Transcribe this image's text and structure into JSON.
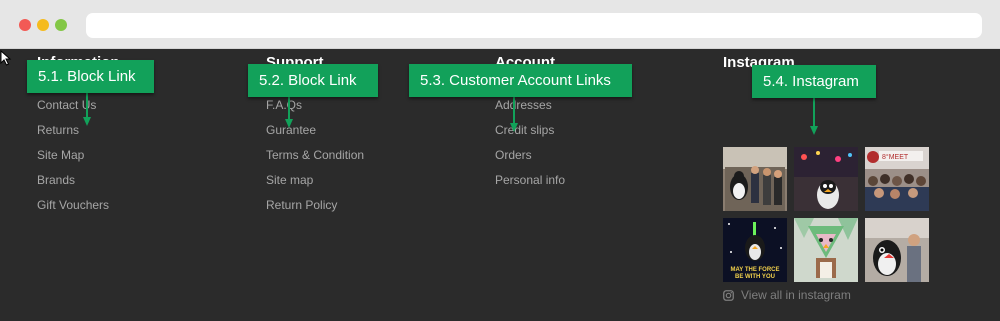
{
  "annotations": {
    "block_link_1": "5.1. Block Link",
    "block_link_2": "5.2. Block Link",
    "customer_account_links": "5.3. Customer Account Links",
    "instagram": "5.4. Instagram"
  },
  "columns": {
    "information": {
      "title": "Information",
      "links": [
        "Contact Us",
        "Returns",
        "Site Map",
        "Brands",
        "Gift Vouchers"
      ]
    },
    "support": {
      "title": "Support",
      "links": [
        "F.A.Qs",
        "Gurantee",
        "Terms & Condition",
        "Site map",
        "Return Policy"
      ]
    },
    "account": {
      "title": "Account",
      "links": [
        "Addresses",
        "Credit slips",
        "Orders",
        "Personal info"
      ]
    },
    "instagram": {
      "title": "Instagram",
      "view_all": "View all in instagram",
      "icon": "instagram-icon"
    }
  },
  "colors": {
    "footer_bg": "#2b2b2b",
    "annotation_green": "#12a15a",
    "link_gray": "#a6a6a6"
  }
}
